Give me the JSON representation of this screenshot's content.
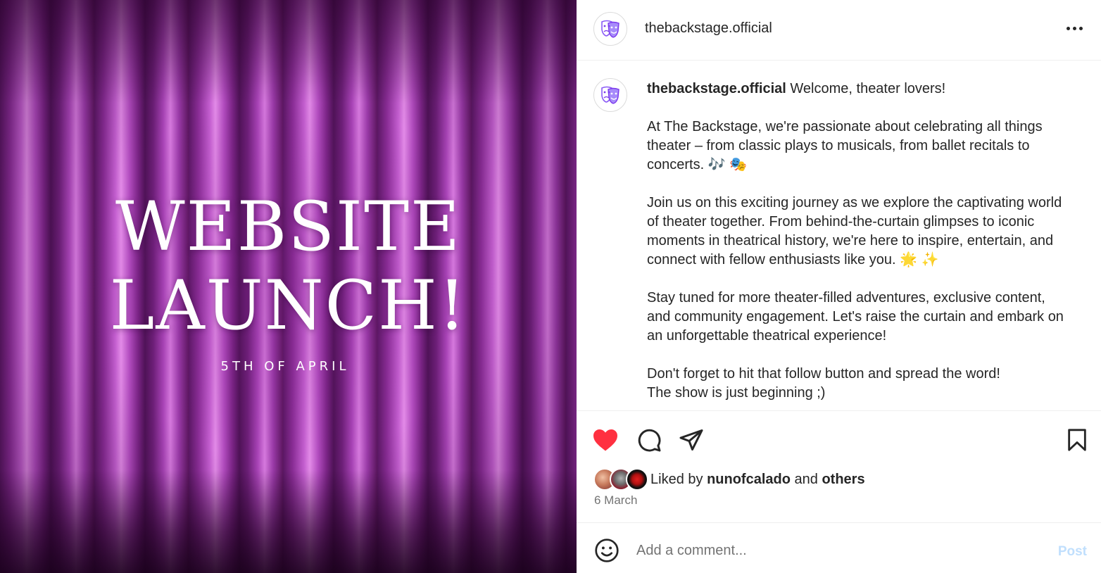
{
  "media": {
    "title_line1": "WEBSITE",
    "title_line2": "LAUNCH!",
    "subtitle": "5TH OF APRIL",
    "background_color": "#8a2d96"
  },
  "header": {
    "username": "thebackstage.official",
    "avatar_icon": "theater-masks-icon",
    "more_icon": "more-options-icon"
  },
  "caption": {
    "username": "thebackstage.official",
    "line1": "Welcome, theater lovers!",
    "paragraph2": "At The Backstage, we're passionate about celebrating all things theater – from classic plays to musicals, from ballet recitals to concerts. 🎶 🎭",
    "paragraph3": "Join us on this exciting journey as we explore the captivating world of theater together. From behind-the-curtain glimpses to iconic moments in theatrical history, we're here to inspire, entertain, and connect with fellow enthusiasts like you. 🌟 ✨",
    "paragraph4": "Stay tuned for more theater-filled adventures, exclusive content, and community engagement. Let's raise the curtain and embark on an unforgettable theatrical experience!",
    "paragraph5_line1": "Don't forget to hit that follow button and spread the word!",
    "paragraph5_line2": "The show is just beginning ;)"
  },
  "actions": {
    "like_icon": "heart-filled-icon",
    "comment_icon": "comment-icon",
    "share_icon": "share-icon",
    "save_icon": "bookmark-icon",
    "like_color": "#ff3040"
  },
  "likes": {
    "prefix": "Liked by",
    "user": "nunofcalado",
    "connector": "and",
    "others": "others"
  },
  "date": "6 March",
  "comment": {
    "placeholder": "Add a comment...",
    "post_label": "Post",
    "emoji_icon": "emoji-icon"
  },
  "colors": {
    "accent_blue": "#0095f6",
    "post_disabled": "#c0dffd",
    "text_primary": "#262626",
    "text_secondary": "#737373"
  }
}
